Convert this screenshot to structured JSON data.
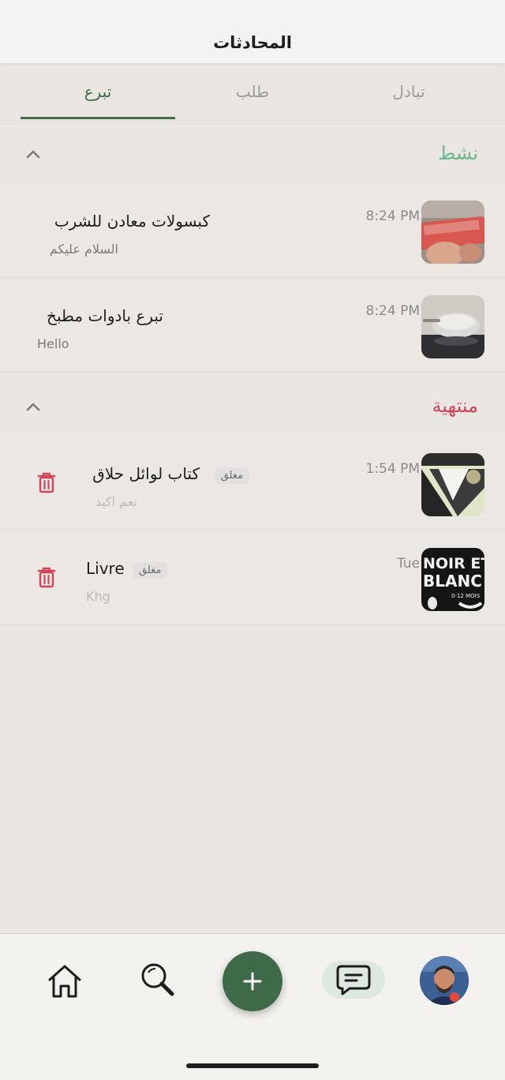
{
  "header": {
    "title": "المحادثات"
  },
  "tabs": [
    {
      "label": "تبادل"
    },
    {
      "label": "طلب"
    },
    {
      "label": "تبرع",
      "active": true
    }
  ],
  "sections": {
    "active": {
      "title": "نشط",
      "items": [
        {
          "title": "كبسولات معادن للشرب",
          "preview": "السلام عليكم",
          "time": "8:24 PM",
          "thumb": "hydratis-icon"
        },
        {
          "title": "تبرع بادوات مطبخ",
          "preview": "Hello",
          "time": "8:24 PM",
          "thumb": "kitchen-pot-icon"
        }
      ]
    },
    "ended": {
      "title": "منتهية",
      "items": [
        {
          "title": "كتاب لوائل حلاق",
          "badge": "مغلق",
          "preview": "نعم اكيد",
          "time": "1:54 PM",
          "thumb": "book-cover-icon"
        },
        {
          "title": "Livre",
          "badge": "مغلق",
          "preview": "Khg",
          "time": "Tue",
          "thumb": "noir-et-blanc-icon",
          "thumb_text": [
            "NOIR ET",
            "BLANC",
            "0-12 MOIS"
          ]
        }
      ]
    }
  },
  "colors": {
    "accent": "#3e6a4a",
    "active_section": "#6bb48f",
    "ended_section": "#d0455a",
    "trash": "#d0455a"
  },
  "navbar": {
    "items": [
      "home-icon",
      "search-icon",
      "plus-icon",
      "chat-icon",
      "avatar"
    ],
    "fab_label": "+"
  }
}
